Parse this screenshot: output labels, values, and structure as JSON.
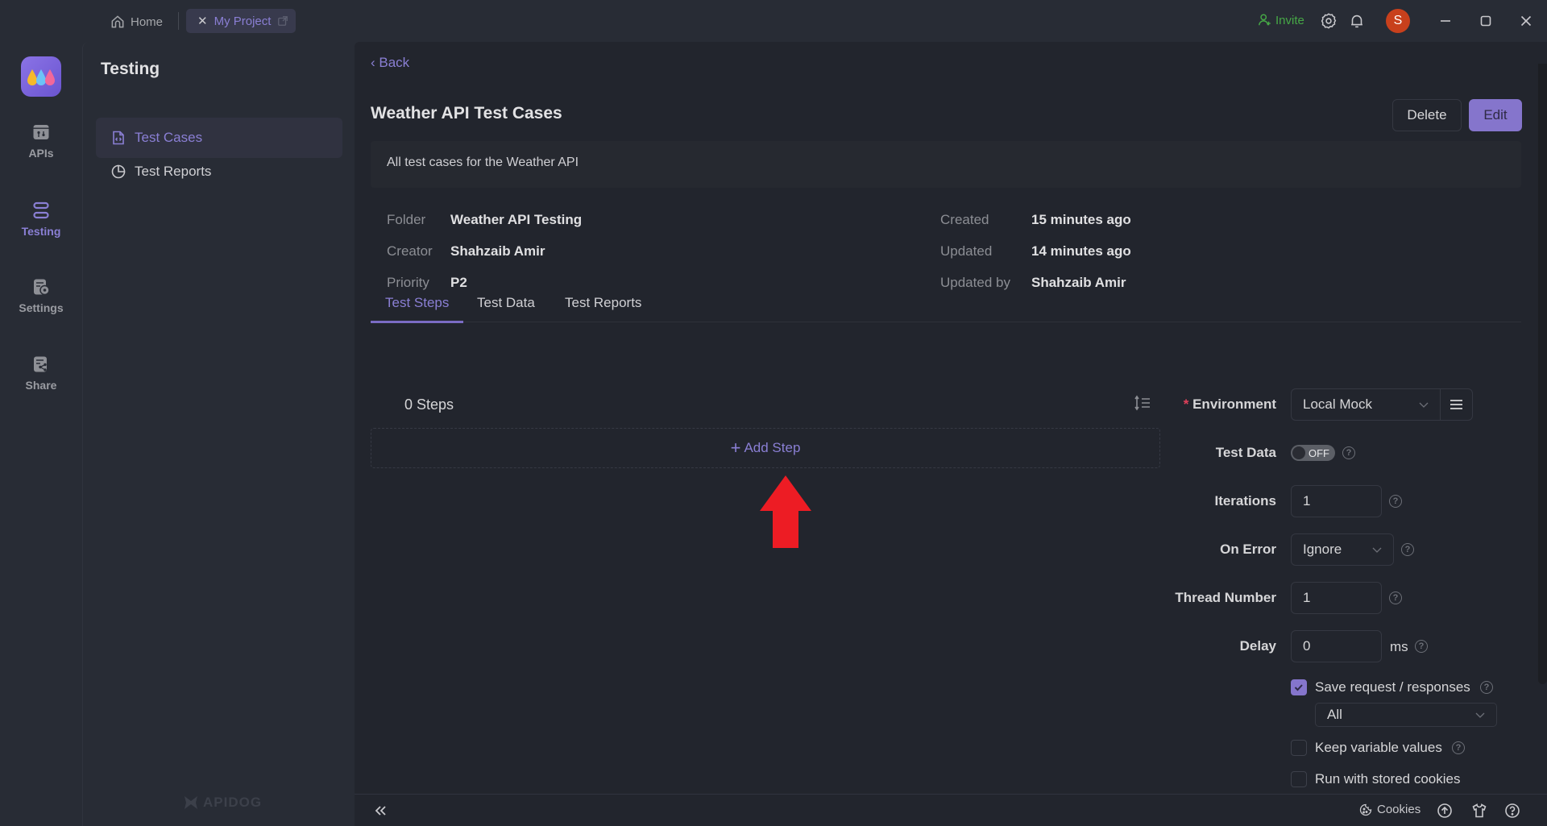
{
  "titlebar": {
    "home_tab": "Home",
    "project_tab": "My Project",
    "invite": "Invite",
    "avatar_initial": "S"
  },
  "rail": {
    "items": [
      {
        "label": "APIs",
        "icon": "api-folder-icon",
        "active": false
      },
      {
        "label": "Testing",
        "icon": "testing-icon",
        "active": true
      },
      {
        "label": "Settings",
        "icon": "settings-icon",
        "active": false
      },
      {
        "label": "Share",
        "icon": "share-icon",
        "active": false
      }
    ]
  },
  "panel": {
    "title": "Testing",
    "items": [
      {
        "label": "Test Cases",
        "icon": "file-code-icon",
        "active": true
      },
      {
        "label": "Test Reports",
        "icon": "pie-chart-icon",
        "active": false
      }
    ],
    "brand": "APIDOG"
  },
  "main": {
    "back": "Back",
    "title": "Weather API Test Cases",
    "delete_label": "Delete",
    "edit_label": "Edit",
    "description": "All test cases for the Weather API",
    "meta_left": [
      {
        "key": "Folder",
        "value": "Weather API Testing"
      },
      {
        "key": "Creator",
        "value": "Shahzaib Amir"
      },
      {
        "key": "Priority",
        "value": "P2"
      }
    ],
    "meta_right": [
      {
        "key": "Created",
        "value": "15 minutes ago"
      },
      {
        "key": "Updated",
        "value": "14 minutes ago"
      },
      {
        "key": "Updated by",
        "value": "Shahzaib Amir"
      }
    ],
    "tabs": [
      {
        "label": "Test Steps",
        "active": true
      },
      {
        "label": "Test Data",
        "active": false
      },
      {
        "label": "Test Reports",
        "active": false
      }
    ],
    "steps_count": "0 Steps",
    "add_step": "Add Step"
  },
  "settings": {
    "environment_label": "Environment",
    "environment_value": "Local Mock",
    "test_data_label": "Test Data",
    "test_data_toggle": "OFF",
    "iterations_label": "Iterations",
    "iterations_value": "1",
    "on_error_label": "On Error",
    "on_error_value": "Ignore",
    "thread_label": "Thread Number",
    "thread_value": "1",
    "delay_label": "Delay",
    "delay_value": "0",
    "delay_unit": "ms",
    "save_req_label": "Save request / responses",
    "save_req_checked": true,
    "save_req_scope": "All",
    "keep_vars_label": "Keep variable values",
    "keep_vars_checked": false,
    "stored_cookies_label": "Run with stored cookies",
    "stored_cookies_checked": false
  },
  "bottombar": {
    "cookies": "Cookies"
  },
  "colors": {
    "accent": "#8575cc",
    "invite_green": "#46a846",
    "avatar_bg": "#c8401c",
    "required_star": "#e0405a",
    "annotation_arrow": "#ed1c24"
  }
}
